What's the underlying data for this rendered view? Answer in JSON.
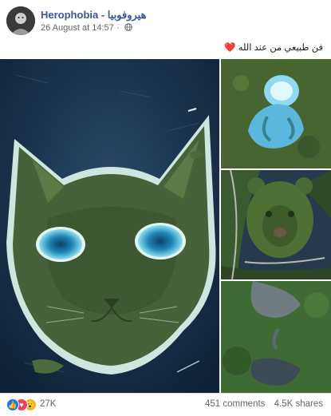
{
  "post": {
    "author": "Herophobia - هيروفوبيا",
    "timestamp": "26 August at 14:57",
    "caption_text": "فن طبيعي من عند الله",
    "caption_emoji": "❤️"
  },
  "reactions": {
    "icons": [
      "like-icon",
      "love-icon",
      "wow-icon"
    ],
    "count": "27K",
    "comments": "451 comments",
    "shares": "4.5K shares"
  },
  "photos": [
    {
      "subject": "cat-shaped-island"
    },
    {
      "subject": "fetus-shaped-lake"
    },
    {
      "subject": "bear-face-forest"
    },
    {
      "subject": "forest-lake"
    }
  ],
  "colors": {
    "author_link": "#385898",
    "secondary_text": "#606770",
    "like_blue": "#1877f2",
    "love_red": "#f33e58",
    "wow_yellow": "#f7b125"
  }
}
